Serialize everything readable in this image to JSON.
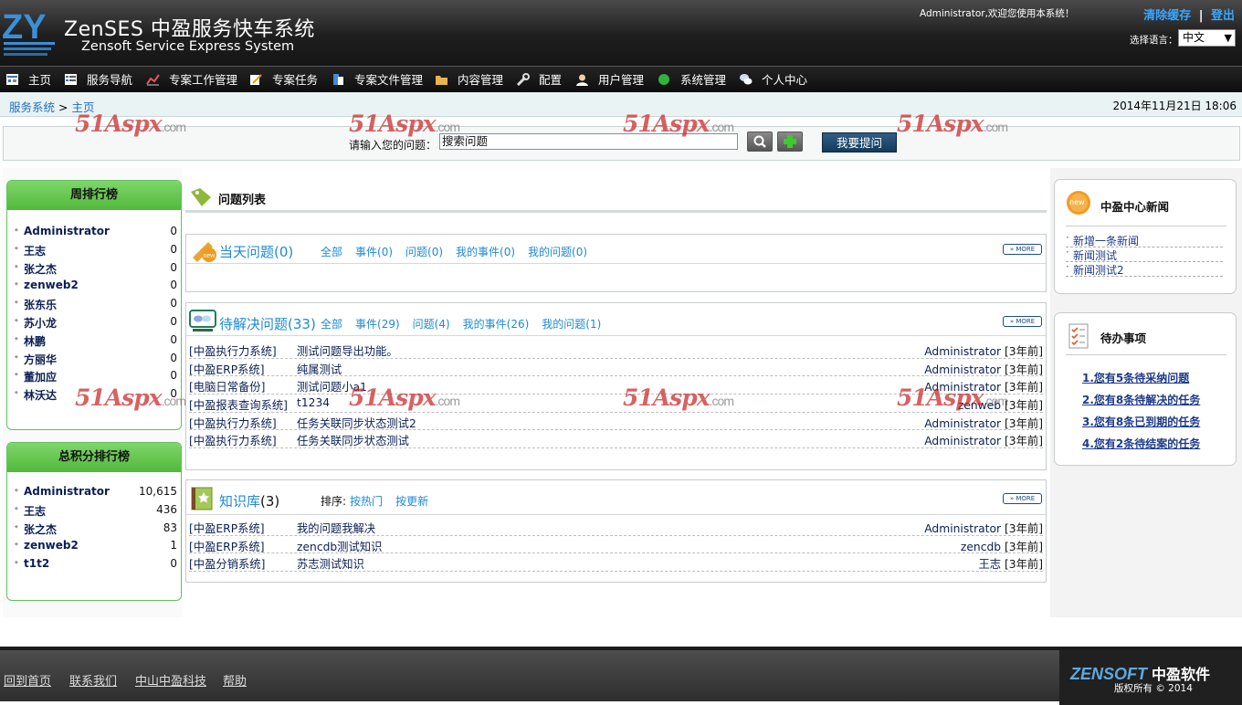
{
  "header": {
    "logo_title": "ZenSES 中盈服务快车系统",
    "logo_subtitle": "Zensoft Service Express System",
    "welcome": "Administrator,欢迎您使用本系统！",
    "clear_cache": "清除缓存",
    "separator": "|",
    "logout": "登出",
    "language_label": "选择语言：",
    "language_value": "中文"
  },
  "nav": [
    {
      "label": "主页",
      "icon": "home-icon"
    },
    {
      "label": "服务导航",
      "icon": "list-icon"
    },
    {
      "label": "专案工作管理",
      "icon": "chart-icon"
    },
    {
      "label": "专案任务",
      "icon": "edit-icon"
    },
    {
      "label": "专案文件管理",
      "icon": "files-icon"
    },
    {
      "label": "内容管理",
      "icon": "folder-icon"
    },
    {
      "label": "配置",
      "icon": "wrench-icon"
    },
    {
      "label": "用户管理",
      "icon": "user-icon"
    },
    {
      "label": "系统管理",
      "icon": "green-dot-icon"
    },
    {
      "label": "个人中心",
      "icon": "chat-icon"
    }
  ],
  "breadcrumb": {
    "root": "服务系统",
    "sep": ">",
    "current": "主页",
    "datetime": "2014年11月21日 18:06"
  },
  "search": {
    "label": "请输入您的问题：",
    "value": "搜索问题",
    "ask_button": "我要提问"
  },
  "watermark": {
    "main": "51Aspx",
    "suffix": ".com"
  },
  "weekly_rank": {
    "title": "周排行榜",
    "rows": [
      {
        "name": "Administrator",
        "value": "0"
      },
      {
        "name": "王志",
        "value": "0"
      },
      {
        "name": "张之杰",
        "value": "0"
      },
      {
        "name": "zenweb2",
        "value": "0"
      },
      {
        "name": "张东乐",
        "value": "0"
      },
      {
        "name": "苏小龙",
        "value": "0"
      },
      {
        "name": "林鹏",
        "value": "0"
      },
      {
        "name": "方丽华",
        "value": "0"
      },
      {
        "name": "董加应",
        "value": "0"
      },
      {
        "name": "林沃达",
        "value": "0"
      }
    ]
  },
  "total_rank": {
    "title": "总积分排行榜",
    "rows": [
      {
        "name": "Administrator",
        "value": "10,615"
      },
      {
        "name": "王志",
        "value": "436"
      },
      {
        "name": "张之杰",
        "value": "83"
      },
      {
        "name": "zenweb2",
        "value": "1"
      },
      {
        "name": "t1t2",
        "value": "0"
      }
    ]
  },
  "question_list": {
    "title": "问题列表",
    "more": "» MORE"
  },
  "today": {
    "title": "当天问题(0)",
    "filters": [
      "全部",
      "事件(0)",
      "问题(0)",
      "我的事件(0)",
      "我的问题(0)"
    ]
  },
  "pending": {
    "title": "待解决问题(33)",
    "filters": [
      "全部",
      "事件(29)",
      "问题(4)",
      "我的事件(26)",
      "我的问题(1)"
    ],
    "rows": [
      {
        "system": "[中盈执行力系统]",
        "title": "测试问题导出功能。",
        "user": "Administrator",
        "ago": "[3年前]"
      },
      {
        "system": "[中盈ERP系统]",
        "title": "纯属测试",
        "user": "Administrator",
        "ago": "[3年前]"
      },
      {
        "system": "[电脑日常备份]",
        "title": "测试问题小a1",
        "user": "Administrator",
        "ago": "[3年前]"
      },
      {
        "system": "[中盈报表查询系统]",
        "title": "t1234",
        "user": "zenweb",
        "ago": "[3年前]"
      },
      {
        "system": "[中盈执行力系统]",
        "title": "任务关联同步状态测试2",
        "user": "Administrator",
        "ago": "[3年前]"
      },
      {
        "system": "[中盈执行力系统]",
        "title": "任务关联同步状态测试",
        "user": "Administrator",
        "ago": "[3年前]"
      }
    ]
  },
  "knowledge": {
    "title": "知识库",
    "count": "(3)",
    "sort_label": "排序:",
    "sort_hot": "按热门",
    "sort_new": "按更新",
    "rows": [
      {
        "system": "[中盈ERP系统]",
        "title": "我的问题我解决",
        "user": "Administrator",
        "ago": "[3年前]"
      },
      {
        "system": "[中盈ERP系统]",
        "title": "zencdb测试知识",
        "user": "zencdb",
        "ago": "[3年前]"
      },
      {
        "system": "[中盈分销系统]",
        "title": "苏志测试知识",
        "user": "王志",
        "ago": "[3年前]"
      }
    ]
  },
  "news": {
    "title": "中盈中心新闻",
    "badge": "new",
    "items": [
      "新增一条新闻",
      "新闻测试",
      "新闻测试2"
    ]
  },
  "todo": {
    "title": "待办事项",
    "items": [
      "1.您有5条待采纳问题",
      "2.您有8条待解决的任务",
      "3.您有8条已到期的任务",
      "4.您有2条待结案的任务"
    ]
  },
  "footer": {
    "links": [
      "回到首页",
      "联系我们",
      "中山中盈科技",
      "帮助"
    ],
    "brand_en": "ZENSOFT",
    "brand_cn": "中盈软件",
    "copyright": "版权所有 © 2014"
  }
}
